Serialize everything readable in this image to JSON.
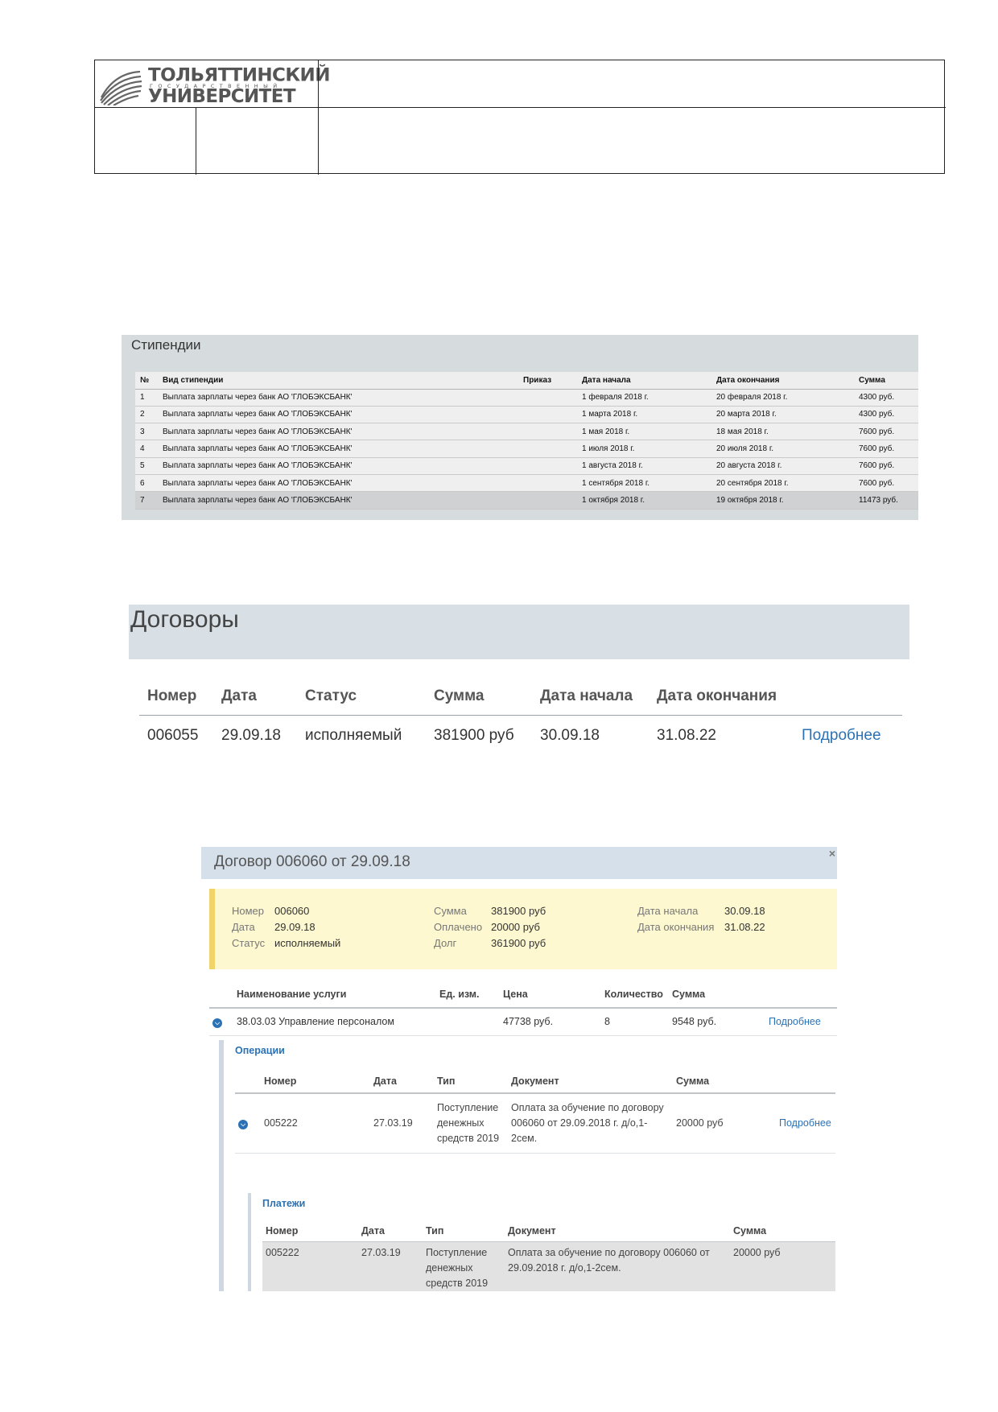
{
  "logo": {
    "line1": "ТОЛЬЯТТИНСКИЙ",
    "line2": "ГОСУДАРСТВЕННЫЙ",
    "line3": "УНИВЕРСИТЕТ"
  },
  "scholarships": {
    "title": "Стипендии",
    "columns": [
      "№",
      "Вид стипендии",
      "Приказ",
      "Дата начала",
      "Дата окончания",
      "Сумма"
    ],
    "rows": [
      {
        "n": "1",
        "kind": "Выплата зарплаты через банк АО 'ГЛОБЭКСБАНК'",
        "order": "",
        "start": "1 февраля 2018 г.",
        "end": "20 февраля 2018 г.",
        "sum": "4300 руб."
      },
      {
        "n": "2",
        "kind": "Выплата зарплаты через банк АО 'ГЛОБЭКСБАНК'",
        "order": "",
        "start": "1 марта 2018 г.",
        "end": "20 марта 2018 г.",
        "sum": "4300 руб."
      },
      {
        "n": "3",
        "kind": "Выплата зарплаты через банк АО 'ГЛОБЭКСБАНК'",
        "order": "",
        "start": "1 мая 2018 г.",
        "end": "18 мая 2018 г.",
        "sum": "7600 руб."
      },
      {
        "n": "4",
        "kind": "Выплата зарплаты через банк АО 'ГЛОБЭКСБАНК'",
        "order": "",
        "start": "1 июля 2018 г.",
        "end": "20 июля 2018 г.",
        "sum": "7600 руб."
      },
      {
        "n": "5",
        "kind": "Выплата зарплаты через банк АО 'ГЛОБЭКСБАНК'",
        "order": "",
        "start": "1 августа 2018 г.",
        "end": "20 августа 2018 г.",
        "sum": "7600 руб."
      },
      {
        "n": "6",
        "kind": "Выплата зарплаты через банк АО 'ГЛОБЭКСБАНК'",
        "order": "",
        "start": "1 сентября 2018 г.",
        "end": "20 сентября 2018 г.",
        "sum": "7600 руб."
      },
      {
        "n": "7",
        "kind": "Выплата зарплаты через банк АО 'ГЛОБЭКСБАНК'",
        "order": "",
        "start": "1 октября 2018 г.",
        "end": "19 октября 2018 г.",
        "sum": "11473 руб."
      }
    ]
  },
  "contracts": {
    "title": "Договоры",
    "columns": [
      "Номер",
      "Дата",
      "Статус",
      "Сумма",
      "Дата начала",
      "Дата окончания"
    ],
    "row": {
      "number": "006055",
      "date": "29.09.18",
      "status": "исполняемый",
      "sum": "381900 руб",
      "start": "30.09.18",
      "end": "31.08.22",
      "link": "Подробнее"
    }
  },
  "contract_modal": {
    "title": "Договор 006060 от 29.09.18",
    "close": "×",
    "summary": {
      "number_label": "Номер",
      "number": "006060",
      "date_label": "Дата",
      "date": "29.09.18",
      "status_label": "Статус",
      "status": "исполняемый",
      "sum_label": "Сумма",
      "sum": "381900 руб",
      "paid_label": "Оплачено",
      "paid": "20000 руб",
      "debt_label": "Долг",
      "debt": "361900 руб",
      "start_label": "Дата начала",
      "start": "30.09.18",
      "end_label": "Дата окончания",
      "end": "31.08.22"
    },
    "services": {
      "columns": [
        "Наименование услуги",
        "Ед. изм.",
        "Цена",
        "Количество",
        "Сумма"
      ],
      "row": {
        "name": "38.03.03 Управление персоналом",
        "unit": "",
        "price": "47738 руб.",
        "qty": "8",
        "sum": "9548 руб.",
        "link": "Подробнее"
      }
    },
    "operations": {
      "title": "Операции",
      "columns": [
        "Номер",
        "Дата",
        "Тип",
        "Документ",
        "Сумма"
      ],
      "row": {
        "number": "005222",
        "date": "27.03.19",
        "type": "Поступление денежных средств 2019",
        "document": "Оплата за обучение по договору 006060 от 29.09.2018 г. д/о,1-2сем.",
        "sum": "20000 руб",
        "link": "Подробнее"
      }
    },
    "payments": {
      "title": "Платежи",
      "columns": [
        "Номер",
        "Дата",
        "Тип",
        "Документ",
        "Сумма"
      ],
      "row": {
        "number": "005222",
        "date": "27.03.19",
        "type": "Поступление денежных средств 2019",
        "document": "Оплата за обучение по договору 006060 от 29.09.2018 г. д/о,1-2сем.",
        "sum": "20000 руб"
      }
    }
  }
}
